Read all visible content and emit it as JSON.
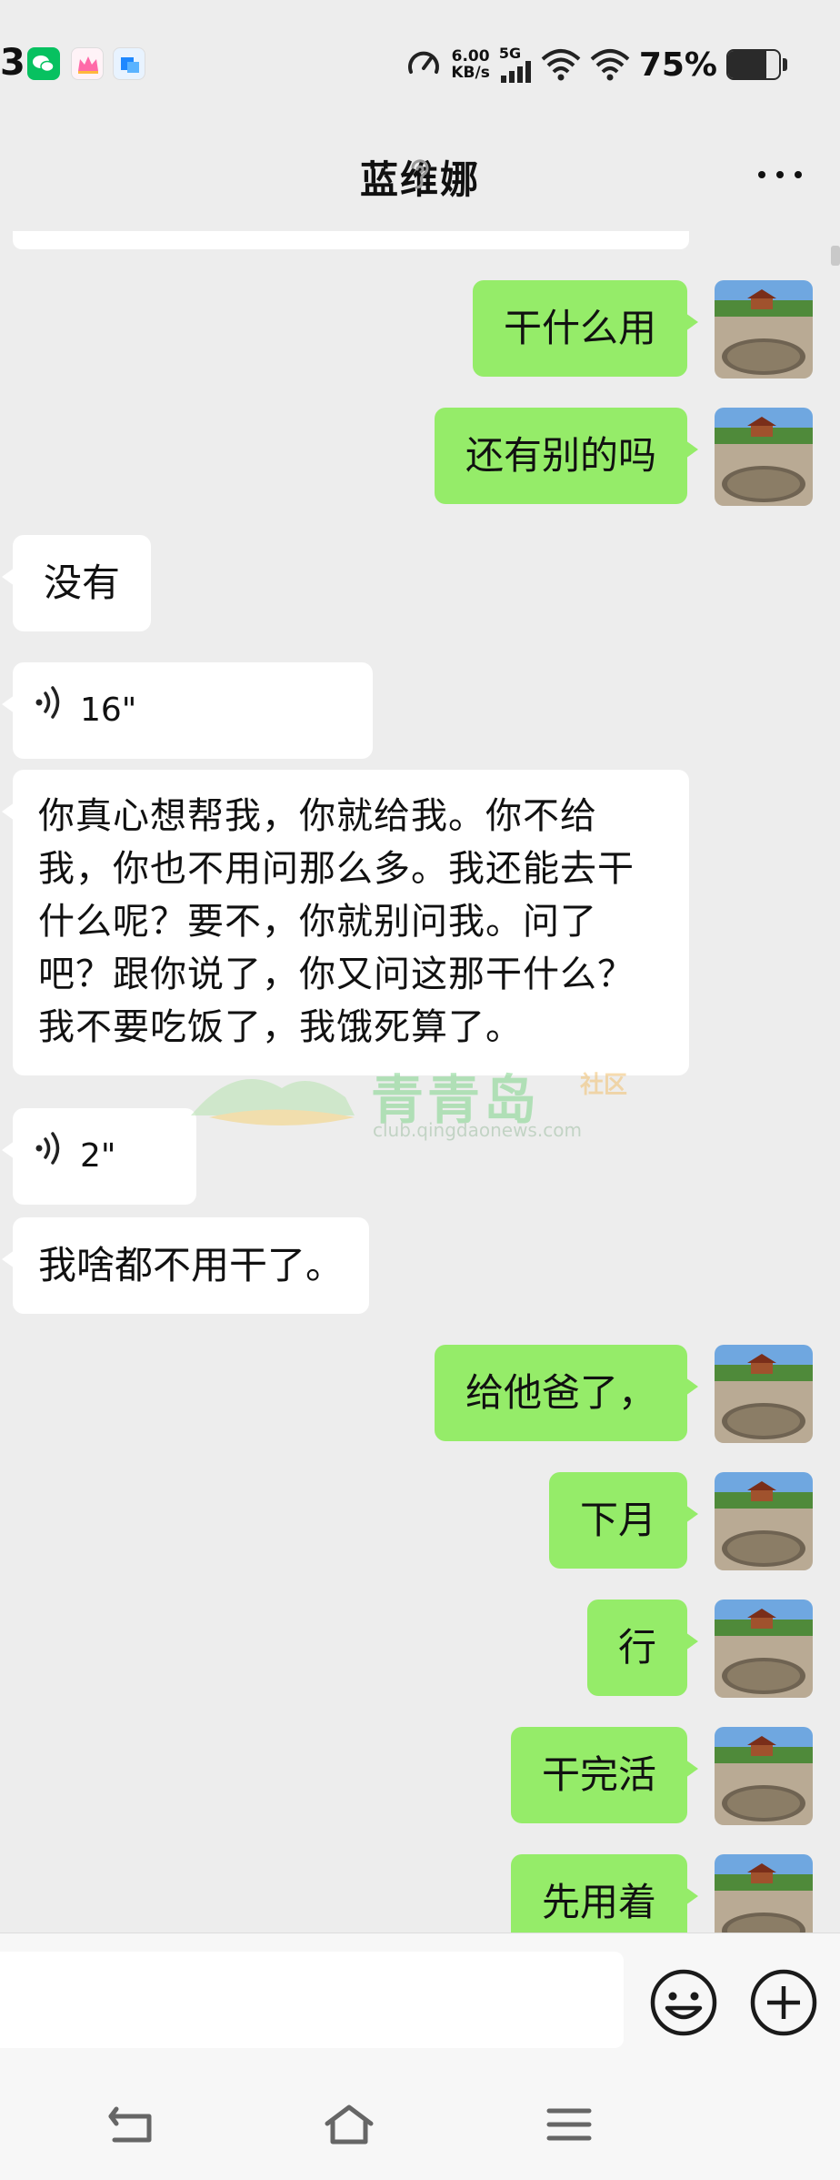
{
  "status_bar": {
    "left_text": "3",
    "speed_value": "6.00",
    "speed_unit": "KB/s",
    "network": "5G",
    "battery_percent": "75%",
    "battery_level": 0.75
  },
  "header": {
    "title": "蓝维娜"
  },
  "messages": [
    {
      "side": "out",
      "text": "干什么用"
    },
    {
      "side": "out",
      "text": "还有别的吗"
    },
    {
      "side": "in",
      "text": "没有"
    },
    {
      "side": "in",
      "type": "voice",
      "text": "16\""
    },
    {
      "side": "in",
      "text": "你真心想帮我，你就给我。你不给我，你也不用问那么多。我还能去干什么呢？要不，你就别问我。问了吧？跟你说了，你又问这那干什么？我不要吃饭了，我饿死算了。"
    },
    {
      "side": "in",
      "type": "voice",
      "text": "2\""
    },
    {
      "side": "in",
      "text": "我啥都不用干了。"
    },
    {
      "side": "out",
      "text": "给他爸了，"
    },
    {
      "side": "out",
      "text": "下月"
    },
    {
      "side": "out",
      "text": "行"
    },
    {
      "side": "out",
      "text": "干完活"
    },
    {
      "side": "out",
      "text": "先用着"
    }
  ],
  "watermark": {
    "name": "青青岛",
    "sub": "社区",
    "url": "club.qingdaonews.com"
  },
  "input": {
    "value": "",
    "placeholder": ""
  },
  "icons": {
    "ear": "ear-icon",
    "more": "more-icon",
    "emoji": "emoji-icon",
    "plus": "plus-icon",
    "nav_back": "back-icon",
    "nav_home": "home-icon",
    "nav_menu": "menu-icon"
  },
  "colors": {
    "outgoing_bubble": "#95ec69",
    "incoming_bubble": "#ffffff",
    "background": "#ededed"
  }
}
